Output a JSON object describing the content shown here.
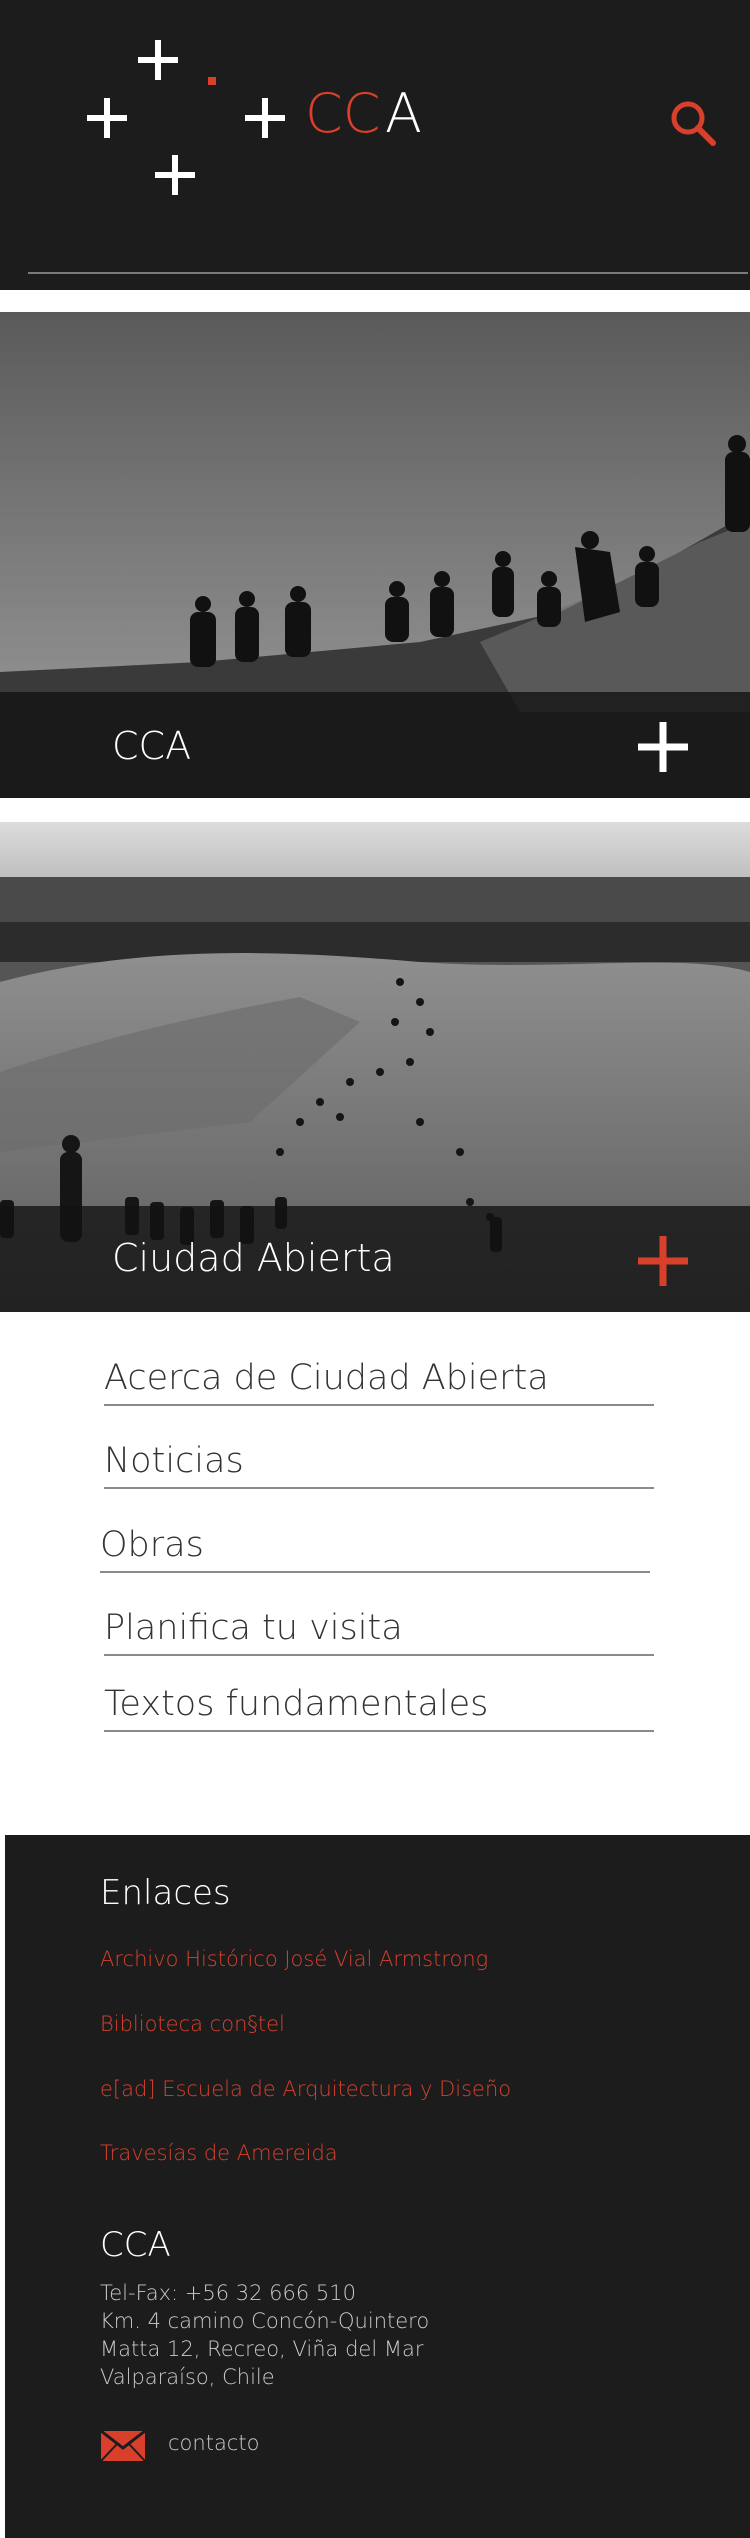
{
  "colors": {
    "accent": "#d8402c",
    "dark": "#1d1c1d",
    "text": "#333333"
  },
  "header": {
    "logo_text_a": "CC",
    "logo_text_b": "A",
    "search_icon": "search-icon"
  },
  "hero": [
    {
      "title": "CCA",
      "icon": "plus-icon"
    },
    {
      "title": "Ciudad Abierta",
      "icon": "plus-icon"
    }
  ],
  "menu": [
    "Acerca de Ciudad Abierta",
    "Noticias",
    "Obras",
    "Planifica tu visita",
    "Textos fundamentales"
  ],
  "footer": {
    "links_heading": "Enlaces",
    "links": [
      "Archivo Histórico José Vial Armstrong",
      "Biblioteca con§tel",
      "e[ad] Escuela de Arquitectura y Diseño",
      "Travesías de Amereida"
    ],
    "org_heading": "CCA",
    "address": [
      "Tel-Fax: +56 32 666 510",
      "Km. 4 camino Concón-Quintero",
      "Matta 12, Recreo, Viña del Mar",
      "Valparaíso, Chile"
    ],
    "contact_label": "contacto",
    "contact_icon": "mail-icon"
  }
}
